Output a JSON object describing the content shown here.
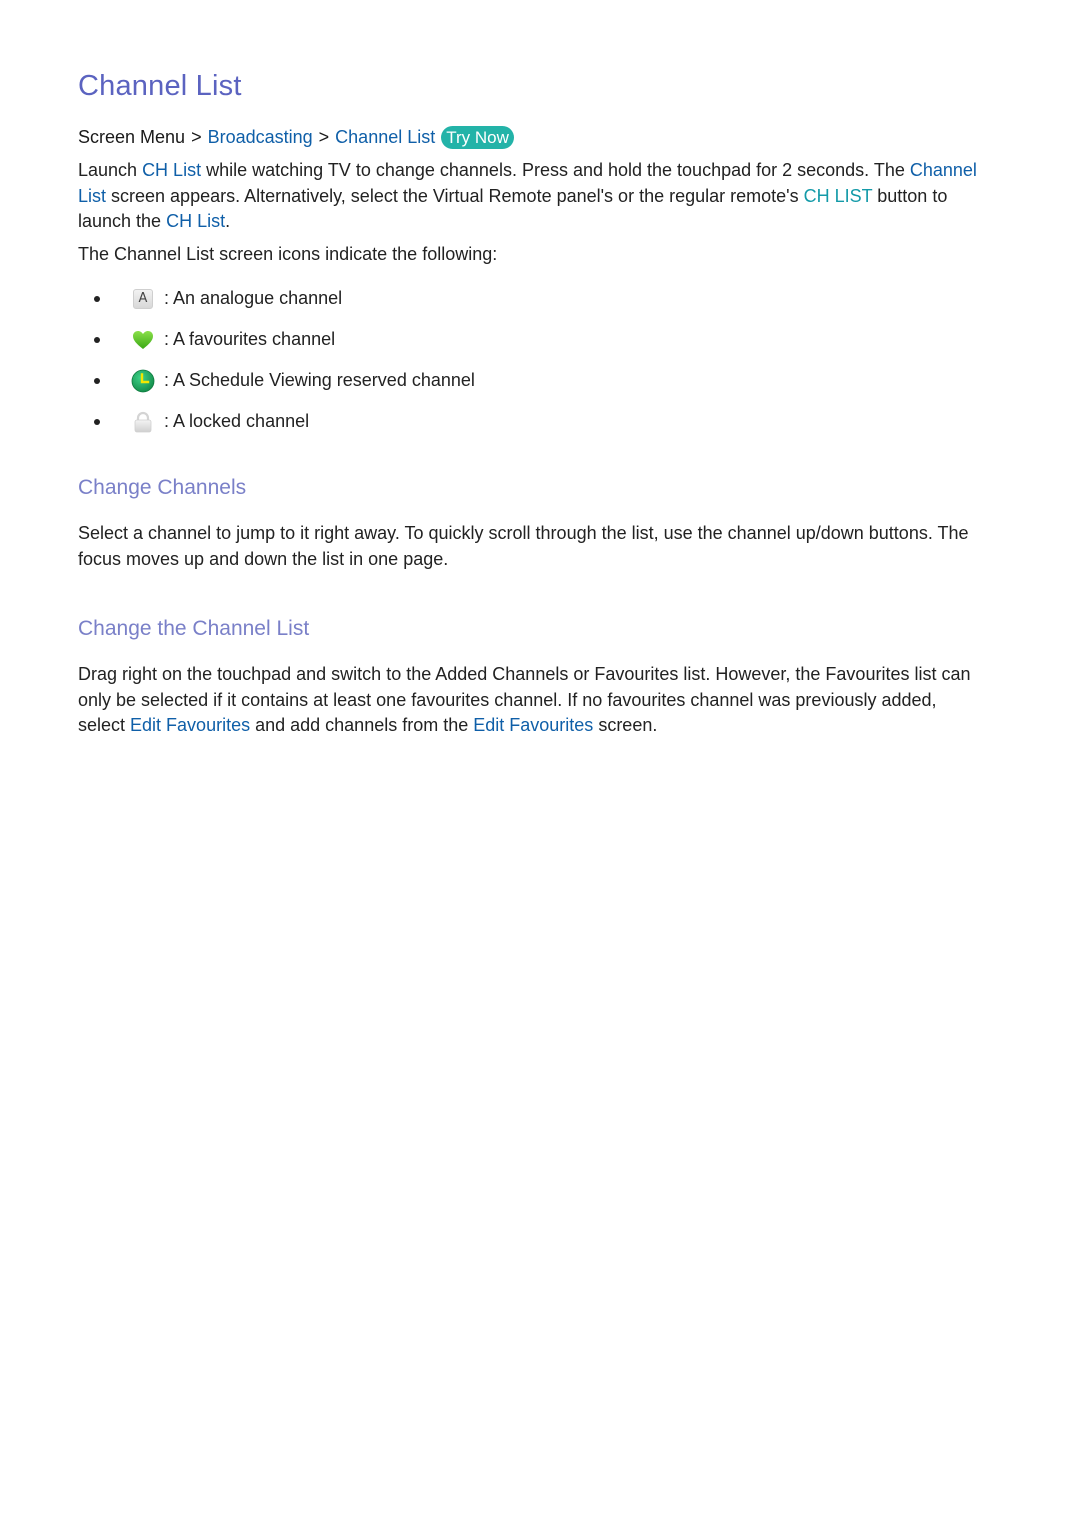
{
  "title": "Channel List",
  "breadcrumb": {
    "root": "Screen Menu",
    "separator": ">",
    "items": [
      "Broadcasting",
      "Channel List"
    ],
    "try_now_label": "Try Now"
  },
  "intro": {
    "p1": [
      {
        "text": "Launch ",
        "style": "plain"
      },
      {
        "text": "CH List",
        "style": "link"
      },
      {
        "text": " while watching TV to change channels. Press and hold the touchpad for 2 seconds. The ",
        "style": "plain"
      },
      {
        "text": "Channel List",
        "style": "link"
      },
      {
        "text": " screen appears. Alternatively, select the Virtual Remote panel's or the regular remote's ",
        "style": "plain"
      },
      {
        "text": "CH LIST",
        "style": "teal"
      },
      {
        "text": " button to launch the ",
        "style": "plain"
      },
      {
        "text": "CH List",
        "style": "link"
      },
      {
        "text": ".",
        "style": "plain"
      }
    ],
    "p2": "The Channel List screen icons indicate the following:"
  },
  "icon_list": [
    {
      "icon": "analogue-icon",
      "glyph": "A",
      "text": ": An analogue channel"
    },
    {
      "icon": "heart-icon",
      "text": ": A favourites channel"
    },
    {
      "icon": "clock-icon",
      "text": ": A Schedule Viewing reserved channel"
    },
    {
      "icon": "lock-icon",
      "text": ": A locked channel"
    }
  ],
  "sections": [
    {
      "heading": "Change Channels",
      "body": "Select a channel to jump to it right away. To quickly scroll through the list, use the channel up/down buttons. The focus moves up and down the list in one page."
    },
    {
      "heading": "Change the Channel List",
      "body": [
        {
          "text": "Drag right on the touchpad and switch to the Added Channels or Favourites list. However, the Favourites list can only be selected if it contains at least one favourites channel. If no favourites channel was previously added, select ",
          "style": "plain"
        },
        {
          "text": "Edit Favourites",
          "style": "link"
        },
        {
          "text": " and add channels from the ",
          "style": "plain"
        },
        {
          "text": "Edit Favourites",
          "style": "link"
        },
        {
          "text": " screen.",
          "style": "plain"
        }
      ]
    }
  ],
  "colors": {
    "title": "#5b63c0",
    "section_heading": "#7a80c8",
    "link": "#0f5fa8",
    "teal_link": "#139aa8",
    "try_now_bg": "#23b3a8",
    "heart_green": "#4cc21c",
    "clock_green": "#1aa35a",
    "clock_hand": "#f2e600"
  }
}
